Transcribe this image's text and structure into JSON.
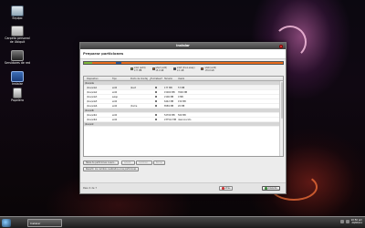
{
  "desktop": {
    "icons": [
      {
        "label": "Equipo",
        "icon": "computer-icon"
      },
      {
        "label": "Carpeta personal de Ubiquit",
        "icon": "home-folder-icon"
      },
      {
        "label": "Servidores de red",
        "icon": "network-drive-icon"
      },
      {
        "label": "Instalar",
        "icon": "installer-icon"
      },
      {
        "label": "Papelera",
        "icon": "trash-icon"
      }
    ]
  },
  "window": {
    "title": "Instalar",
    "header": "Preparar particiones",
    "partitions_bar": [
      {
        "color": "#7cb63a",
        "fraction": 0.04
      },
      {
        "color": "#e86a1c",
        "fraction": 0.12
      },
      {
        "color": "#2d4f8a",
        "fraction": 0.03
      },
      {
        "color": "#e86a1c",
        "fraction": 0.81
      }
    ],
    "legend": [
      {
        "color": "#7cb63a",
        "name": "sda1 (ext4)",
        "size": "177 MB"
      },
      {
        "color": "#e86a1c",
        "name": "sda2 (ext4)",
        "size": "15.0 GB"
      },
      {
        "color": "#2d4f8a",
        "name": "sda3 (linux-swap)",
        "size": "2.1 GB"
      },
      {
        "color": "#e86a1c",
        "name": "sda6 (ext4)",
        "size": "170.9 GB"
      }
    ],
    "table": {
      "columns": [
        "Dispositivo",
        "Tipo",
        "Punto de montaje",
        "¿Formatear?",
        "Tamaño",
        "Usado",
        ""
      ],
      "rows": [
        {
          "group": true,
          "device": "/dev/sda"
        },
        {
          "device": "/dev/sda1",
          "type": "ext4",
          "mount": "/boot",
          "format": true,
          "size": "177 MB",
          "used": "57 MB"
        },
        {
          "device": "/dev/sda2",
          "type": "ext4",
          "mount": "",
          "format": false,
          "size": "15000 MB",
          "used": "3500 MB"
        },
        {
          "device": "/dev/sda3",
          "type": "swap",
          "mount": "",
          "format": false,
          "size": "2106 MB",
          "used": "0 MB"
        },
        {
          "device": "/dev/sda5",
          "type": "ext4",
          "mount": "",
          "format": false,
          "size": "6442 MB",
          "used": "150 MB"
        },
        {
          "device": "/dev/sda6",
          "type": "ext4",
          "mount": "/home",
          "format": false,
          "size": "8589 MB",
          "used": "20 MB"
        },
        {
          "group": true,
          "device": "/dev/sdb"
        },
        {
          "device": "/dev/sdb1",
          "type": "ext4",
          "mount": "",
          "format": false,
          "size": "52709 MB",
          "used": "500 MB"
        },
        {
          "device": "/dev/sdb2",
          "type": "ext4",
          "mount": "",
          "format": false,
          "size": "237512 MB",
          "used": "desconocido"
        },
        {
          "group": true,
          "device": "/dev/sdc"
        }
      ]
    },
    "buttons": {
      "new_table": "Tabla de particiones nueva...",
      "add": "Añadir...",
      "change": "Cambiar...",
      "delete": "Borrar",
      "revert": "Revertir los cambios realizados a las particiones",
      "back": "Atrás",
      "next": "Adelante"
    },
    "step": "Paso 4 de 7"
  },
  "taskbar": {
    "task": "Instalar",
    "time": "10:56 am",
    "date": "29/08/11"
  }
}
